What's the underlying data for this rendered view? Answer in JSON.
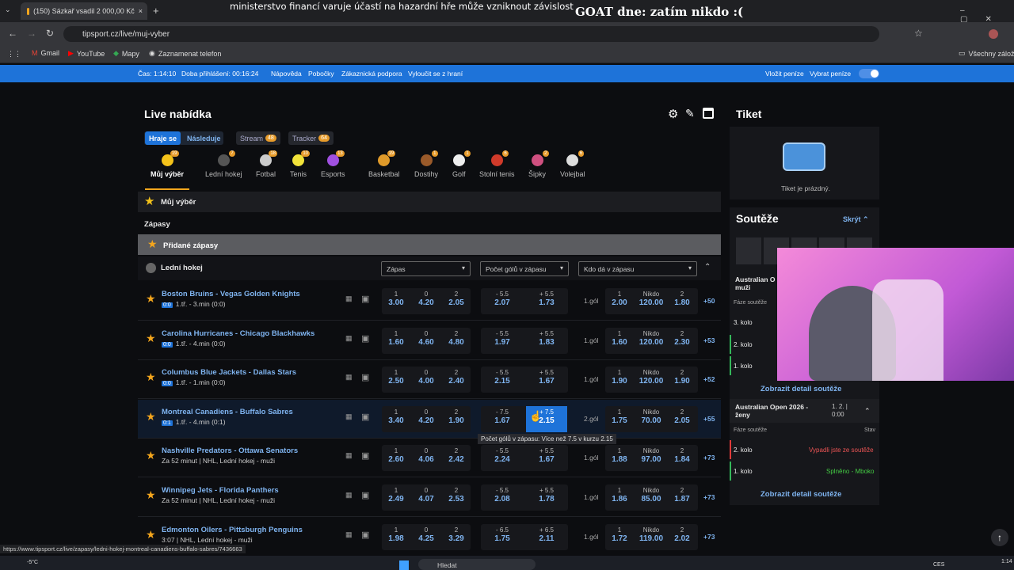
{
  "browser": {
    "tab_title": "(150) Sázkař vsadil 2 000,00 Kč",
    "url": "tipsport.cz/live/muj-vyber",
    "bookmarks": [
      "Gmail",
      "YouTube",
      "Mapy",
      "Zaznamenat telefon"
    ],
    "all_bookmarks": "Všechny záložk"
  },
  "overlay": {
    "warning": "ministerstvo financí varuje účastí na hazardní hře může vzniknout závislost",
    "goat": "GOAT dne: zatím nikdo :("
  },
  "topbar": {
    "time": "Čas: 1:14:10",
    "login": "Doba přihlášení: 00:16:24",
    "help": "Nápověda",
    "branches": "Pobočky",
    "support": "Zákaznická podpora",
    "gamble_out": "Vyloučit se z hraní",
    "deposit": "Vložit peníze",
    "withdraw": "Vybrat peníze"
  },
  "live": {
    "title": "Live nabídka",
    "tabs": {
      "playing": "Hraje se",
      "next": "Následuje",
      "stream": "Stream",
      "stream_count": "48",
      "tracker": "Tracker",
      "tracker_count": "64"
    },
    "sports": [
      {
        "label": "Můj výběr",
        "count": "19",
        "color": "#f4c21a"
      },
      {
        "label": "Lední hokej",
        "count": "7",
        "color": "#555"
      },
      {
        "label": "Fotbal",
        "count": "18",
        "color": "#ccc"
      },
      {
        "label": "Tenis",
        "count": "10",
        "color": "#f2e33a"
      },
      {
        "label": "Esports",
        "count": "13",
        "color": "#a050e0"
      },
      {
        "label": "Basketbal",
        "count": "19",
        "color": "#e09a2a"
      },
      {
        "label": "Dostihy",
        "count": "1",
        "color": "#9a5a2a"
      },
      {
        "label": "Golf",
        "count": "1",
        "color": "#eee"
      },
      {
        "label": "Stolní tenis",
        "count": "6",
        "color": "#d03a2a"
      },
      {
        "label": "Šipky",
        "count": "2",
        "color": "#d05080"
      },
      {
        "label": "Volejbal",
        "count": "6",
        "color": "#ddd"
      }
    ],
    "my_choice": "Můj výběr",
    "matches": "Zápasy",
    "added": "Přidané zápasy",
    "league": "Lední hokej",
    "selects": [
      "Zápas",
      "Počet gólů v zápasu",
      "Kdo dá v zápasu"
    ],
    "tooltip": "Počet gólů v zápasu: Více než 7.5 v kurzu 2.15"
  },
  "rows": [
    {
      "name": "Boston Bruins - Vegas Golden Knights",
      "score": "0:0",
      "sub": "1.tř. - 3.min (0:0)",
      "o1": "3.00",
      "o0": "4.20",
      "o2": "2.05",
      "ul": "- 5.5",
      "uv": "2.07",
      "pl": "+ 5.5",
      "pv": "1.73",
      "goal": "1.gól",
      "k1": "2.00",
      "kn": "120.00",
      "k2": "1.80",
      "more": "+50"
    },
    {
      "name": "Carolina Hurricanes - Chicago Blackhawks",
      "score": "0:0",
      "sub": "1.tř. - 4.min (0:0)",
      "o1": "1.60",
      "o0": "4.60",
      "o2": "4.80",
      "ul": "- 5.5",
      "uv": "1.97",
      "pl": "+ 5.5",
      "pv": "1.83",
      "goal": "1.gól",
      "k1": "1.60",
      "kn": "120.00",
      "k2": "2.30",
      "more": "+53"
    },
    {
      "name": "Columbus Blue Jackets - Dallas Stars",
      "score": "0:0",
      "sub": "1.tř. - 1.min (0:0)",
      "o1": "2.50",
      "o0": "4.00",
      "o2": "2.40",
      "ul": "- 5.5",
      "uv": "2.15",
      "pl": "+ 5.5",
      "pv": "1.67",
      "goal": "1.gól",
      "k1": "1.90",
      "kn": "120.00",
      "k2": "1.90",
      "more": "+52"
    },
    {
      "name": "Montreal Canadiens - Buffalo Sabres",
      "score": "0:1",
      "sub": "1.tř. - 4.min (0:1)",
      "o1": "3.40",
      "o0": "4.20",
      "o2": "1.90",
      "ul": "- 7.5",
      "uv": "1.67",
      "pl": "+ 7.5",
      "pv": "2.15",
      "goal": "2.gól",
      "k1": "1.75",
      "kn": "70.00",
      "k2": "2.05",
      "more": "+55"
    },
    {
      "name": "Nashville Predators - Ottawa Senators",
      "score": "",
      "sub": "Za 52 minut | NHL, Lední hokej - muži",
      "o1": "2.60",
      "o0": "4.06",
      "o2": "2.42",
      "ul": "- 5.5",
      "uv": "2.24",
      "pl": "+ 5.5",
      "pv": "1.67",
      "goal": "1.gól",
      "k1": "1.88",
      "kn": "97.00",
      "k2": "1.84",
      "more": "+73"
    },
    {
      "name": "Winnipeg Jets - Florida Panthers",
      "score": "",
      "sub": "Za 52 minut | NHL, Lední hokej - muži",
      "o1": "2.49",
      "o0": "4.07",
      "o2": "2.53",
      "ul": "- 5.5",
      "uv": "2.08",
      "pl": "+ 5.5",
      "pv": "1.78",
      "goal": "1.gól",
      "k1": "1.86",
      "kn": "85.00",
      "k2": "1.87",
      "more": "+73"
    },
    {
      "name": "Edmonton Oilers - Pittsburgh Penguins",
      "score": "",
      "sub": "3:07 | NHL, Lední hokej - muži",
      "o1": "1.98",
      "o0": "4.25",
      "o2": "3.29",
      "ul": "- 6.5",
      "uv": "1.75",
      "pl": "+ 6.5",
      "pv": "2.11",
      "goal": "1.gól",
      "k1": "1.72",
      "kn": "119.00",
      "k2": "2.02",
      "more": "+73"
    }
  ],
  "labels": {
    "one": "1",
    "zero": "0",
    "two": "2",
    "nobody": "Nikdo"
  },
  "ticket": {
    "title": "Tiket",
    "empty": "Tiket je prázdný."
  },
  "comps": {
    "title": "Soutěže",
    "hide": "Skrýt",
    "c1": "Australian O",
    "c1b": "muži",
    "phase": "Fáze soutěže",
    "state": "Stav",
    "r3": "3. kolo",
    "r2": "2. kolo",
    "r1": "1. kolo",
    "detail": "Zobrazit detail soutěže",
    "c2": "Australian Open 2026 - ženy",
    "c2score": "1. 2. | 0:00",
    "out": "Vypadli jste ze soutěže",
    "done": "Splněno - Mboko"
  },
  "status_url": "https://www.tipsport.cz/live/zapasy/ledni-hokej-montreal-canadiens-buffalo-sabres/7436663",
  "taskbar": {
    "temp": "-5°C",
    "search": "Hledat",
    "lang": "CES",
    "clock": "1:14"
  }
}
